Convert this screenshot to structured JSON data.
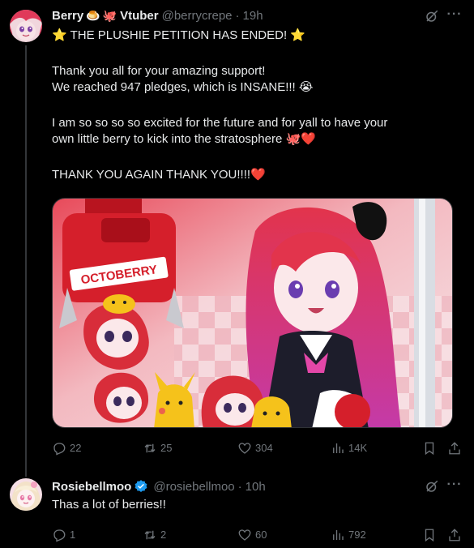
{
  "tweets": [
    {
      "author": {
        "name": "Berry",
        "name_emojis": [
          "🍮",
          "🐙"
        ],
        "name_suffix": "Vtuber",
        "handle": "@berrycrepe",
        "time": "19h"
      },
      "lines": [
        "⭐ THE PLUSHIE PETITION HAS ENDED! ⭐",
        "",
        "Thank you all for your amazing support!",
        "We reached 947 pledges, which is INSANE!!! 😭",
        "",
        "I am so so so so excited for the future and for yall to have your",
        "own little berry to kick into the stratosphere 🐙❤️",
        "",
        "THANK YOU AGAIN THANK YOU!!!!❤️"
      ],
      "media": {
        "sign_text": "OCTOBERRY"
      },
      "stats": {
        "replies": "22",
        "reposts": "25",
        "likes": "304",
        "views": "14K"
      }
    },
    {
      "author": {
        "name": "Rosiebellmoo",
        "verified": true,
        "handle": "@rosiebellmoo",
        "time": "10h"
      },
      "lines": [
        "Thas a lot of berries!!"
      ],
      "stats": {
        "replies": "1",
        "reposts": "2",
        "likes": "60",
        "views": "792"
      }
    }
  ],
  "colors": {
    "background": "#000000",
    "text": "#e7e9ea",
    "muted": "#71767b",
    "verified": "#1d9bf0"
  },
  "icons": {
    "reply": "reply-icon",
    "repost": "repost-icon",
    "like": "heart-icon",
    "views": "views-icon",
    "bookmark": "bookmark-icon",
    "share": "share-icon",
    "grok": "grok-icon",
    "more": "more-icon"
  }
}
